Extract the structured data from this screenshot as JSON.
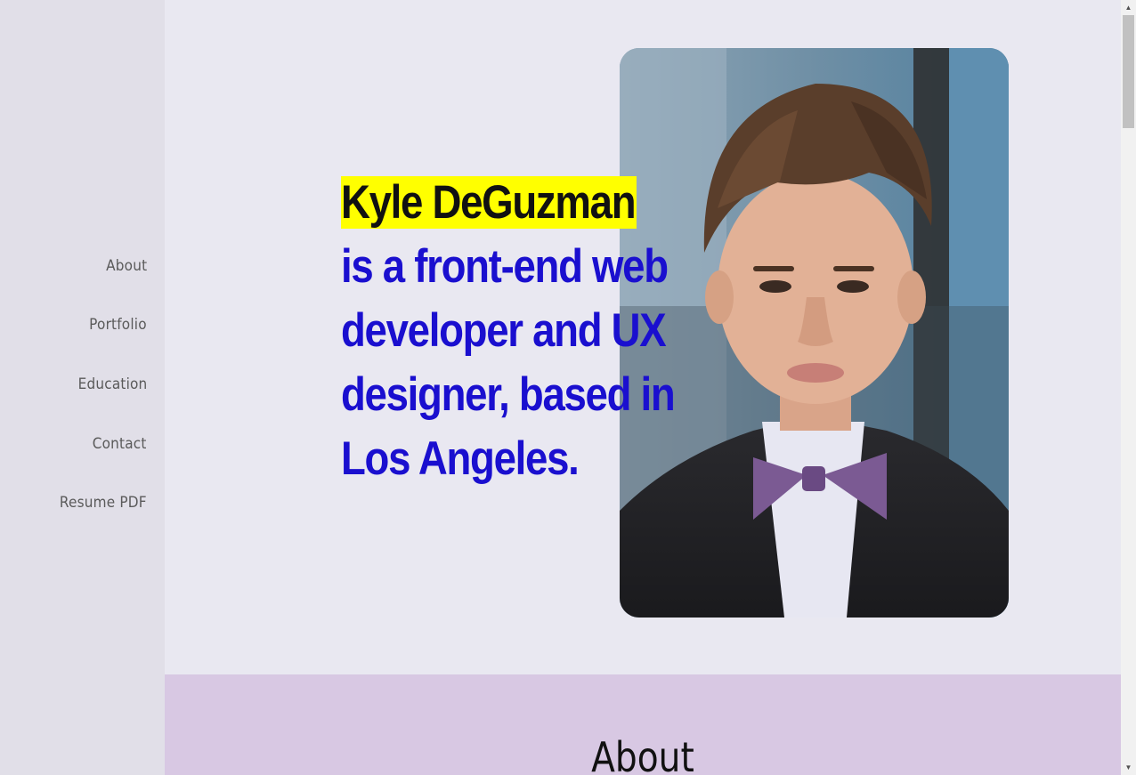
{
  "nav": {
    "items": [
      {
        "label": "About"
      },
      {
        "label": "Portfolio"
      },
      {
        "label": "Education"
      },
      {
        "label": "Contact"
      },
      {
        "label": "Resume PDF"
      }
    ]
  },
  "hero": {
    "name": "Kyle DeGuzman",
    "headline_rest": " is a front-end web developer and UX designer, based in Los Angeles.",
    "photo_alt": "portrait-photo",
    "colors": {
      "headline": "#1a0fcf",
      "highlight": "#ffff00"
    }
  },
  "about": {
    "title": "About"
  },
  "scrollbar": {
    "up_icon": "▲",
    "down_icon": "▼"
  }
}
